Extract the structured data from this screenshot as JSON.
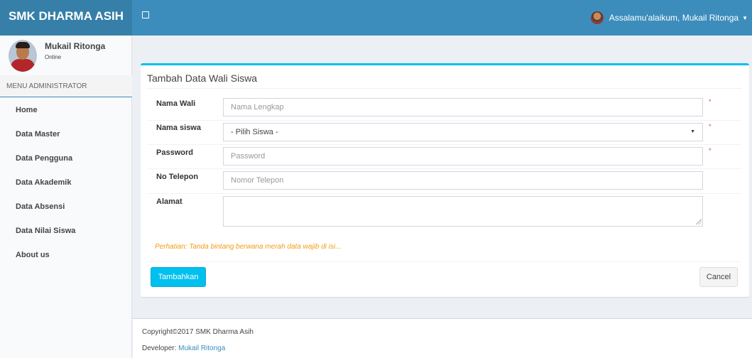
{
  "header": {
    "logo": "SMK DHARMA ASIH",
    "greeting": "Assalamu'alaikum, Mukail Ritonga"
  },
  "sidebar": {
    "user_name": "Mukail Ritonga",
    "user_status": "Online",
    "menu_header": "MENU ADMINISTRATOR",
    "items": [
      {
        "label": "Home"
      },
      {
        "label": "Data Master"
      },
      {
        "label": "Data Pengguna"
      },
      {
        "label": "Data Akademik"
      },
      {
        "label": "Data Absensi"
      },
      {
        "label": "Data Nilai Siswa"
      },
      {
        "label": "About us"
      }
    ]
  },
  "form": {
    "title": "Tambah Data Wali Siswa",
    "fields": {
      "nama_wali": {
        "label": "Nama Wali",
        "placeholder": "Nama Lengkap",
        "required": "*"
      },
      "nama_siswa": {
        "label": "Nama siswa",
        "selected": "- Pilih Siswa -",
        "required": "*"
      },
      "password": {
        "label": "Password",
        "placeholder": "Password",
        "required": "*"
      },
      "telepon": {
        "label": "No Telepon",
        "placeholder": "Nomor Telepon"
      },
      "alamat": {
        "label": "Alamat"
      }
    },
    "note": "Perhatian: Tanda bintang berwana merah data wajib di isi...",
    "submit_label": "Tambahkan",
    "cancel_label": "Cancel"
  },
  "footer": {
    "copyright": "Copyright©2017 SMK Dharma Asih",
    "developer_label": "Developer: ",
    "developer_name": "Mukail Ritonga"
  },
  "colors": {
    "header": "#3c8dbc",
    "logo_bg": "#367fa9",
    "accent": "#00c0ef",
    "required": "#dd4b39",
    "warning": "#f39c12"
  },
  "icons": {
    "sidebar_toggle": "square-toggle-icon",
    "user_avatar": "user-avatar-icon",
    "dropdown": "caret-down-icon"
  }
}
